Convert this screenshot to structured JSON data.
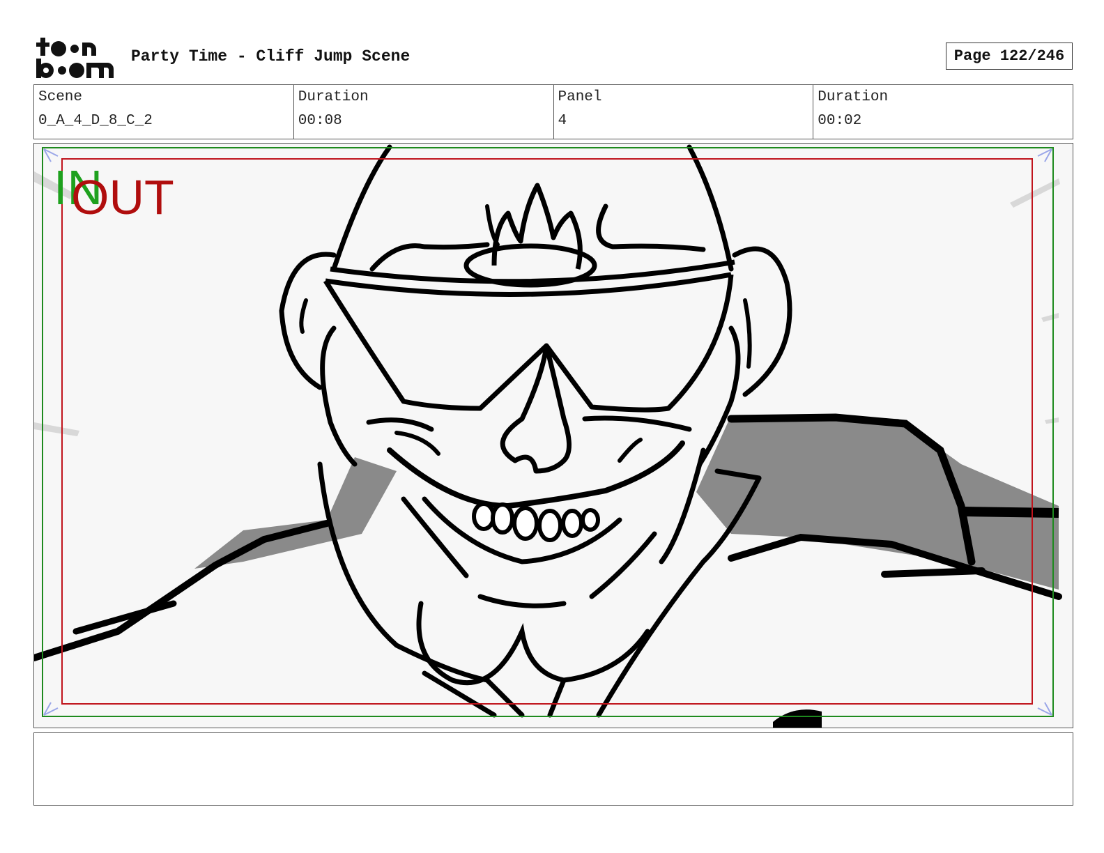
{
  "header": {
    "logo_top": "toon",
    "logo_bottom": "boom",
    "title": "Party Time - Cliff Jump Scene",
    "page": "Page 122/246"
  },
  "info": {
    "scene_label": "Scene",
    "scene_value": "0_A_4_D_8_C_2",
    "scene_duration_label": "Duration",
    "scene_duration_value": "00:08",
    "panel_label": "Panel",
    "panel_value": "4",
    "panel_duration_label": "Duration",
    "panel_duration_value": "00:02"
  },
  "panel": {
    "in_label": "IN",
    "out_label": "OUT",
    "in_frame_color": "#1e8a1e",
    "out_frame_color": "#c0141c"
  },
  "notes": {
    "text": ""
  }
}
